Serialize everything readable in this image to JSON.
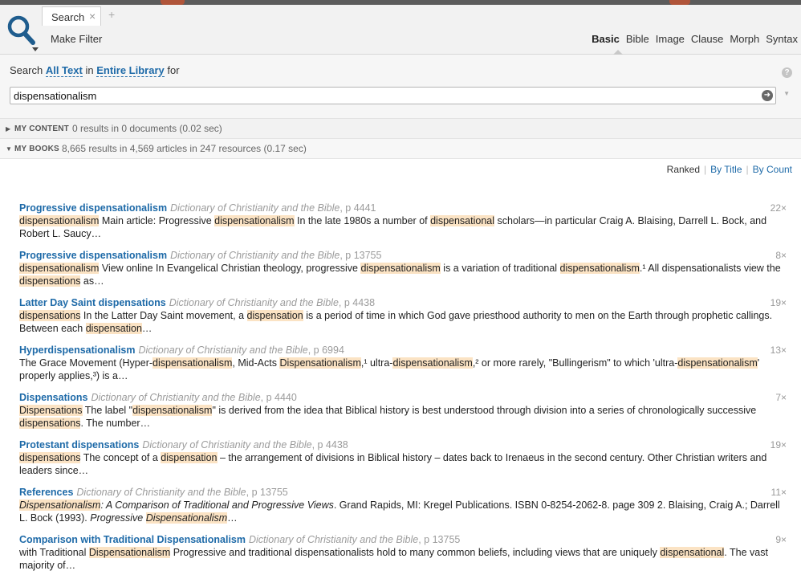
{
  "tab": {
    "label": "Search",
    "close": "×",
    "add": "+"
  },
  "toolbar": {
    "make_filter": "Make Filter"
  },
  "modes": [
    "Basic",
    "Bible",
    "Image",
    "Clause",
    "Morph",
    "Syntax"
  ],
  "query": {
    "prefix": "Search",
    "scope": "All Text",
    "in": "in",
    "collection": "Entire Library",
    "suffix": "for",
    "value": "dispensationalism",
    "help": "?",
    "go": "➜",
    "menu": "▼"
  },
  "sections": [
    {
      "title": "MY CONTENT",
      "info": "0 results in 0 documents (0.02 sec)"
    },
    {
      "title": "MY BOOKS",
      "info": "8,665 results in 4,569 articles in 247 resources (0.17 sec)"
    }
  ],
  "sort": {
    "ranked": "Ranked",
    "by_title": "By Title",
    "by_count": "By Count",
    "sep": "|"
  },
  "colors": {
    "link": "#1e6aa8",
    "highlight": "#fbe3c4"
  },
  "results": [
    {
      "title": "Progressive dispensationalism",
      "source": "Dictionary of Christianity and the Bible",
      "page": ", p 4441",
      "count": "22×",
      "snippet": [
        {
          "t": "dispensationalism",
          "h": true
        },
        {
          "t": " Main article: Progressive "
        },
        {
          "t": "dispensationalism",
          "h": true
        },
        {
          "t": " In the late 1980s a number of "
        },
        {
          "t": "dispensational",
          "h": true
        },
        {
          "t": " scholars—in particular Craig A. Blaising, Darrell L. Bock, and Robert L. Saucy…"
        }
      ]
    },
    {
      "title": "Progressive dispensationalism",
      "source": "Dictionary of Christianity and the Bible",
      "page": ", p 13755",
      "count": "8×",
      "snippet": [
        {
          "t": "dispensationalism",
          "h": true
        },
        {
          "t": " View online In Evangelical Christian theology, progressive "
        },
        {
          "t": "dispensationalism",
          "h": true
        },
        {
          "t": " is a variation of traditional "
        },
        {
          "t": "dispensationalism",
          "h": true
        },
        {
          "t": ".¹ All dispensationalists view the "
        },
        {
          "t": "dispensations",
          "h": true
        },
        {
          "t": " as…"
        }
      ]
    },
    {
      "title": "Latter Day Saint dispensations",
      "source": "Dictionary of Christianity and the Bible",
      "page": ", p 4438",
      "count": "19×",
      "snippet": [
        {
          "t": "dispensations",
          "h": true
        },
        {
          "t": " In the Latter Day Saint movement, a "
        },
        {
          "t": "dispensation",
          "h": true
        },
        {
          "t": " is a period of time in which God gave priesthood authority to men on the Earth through prophetic callings. Between each "
        },
        {
          "t": "dispensation",
          "h": true
        },
        {
          "t": "…"
        }
      ]
    },
    {
      "title": "Hyperdispensationalism",
      "source": "Dictionary of Christianity and the Bible",
      "page": ", p 6994",
      "count": "13×",
      "snippet": [
        {
          "t": "The Grace Movement (Hyper-"
        },
        {
          "t": "dispensationalism",
          "h": true
        },
        {
          "t": ", Mid-Acts "
        },
        {
          "t": "Dispensationalism",
          "h": true
        },
        {
          "t": ",¹ ultra-"
        },
        {
          "t": "dispensationalism",
          "h": true
        },
        {
          "t": ",² or more rarely, \"Bullingerism\" to which 'ultra-"
        },
        {
          "t": "dispensationalism",
          "h": true
        },
        {
          "t": "' properly applies,³) is a…"
        }
      ]
    },
    {
      "title": "Dispensations",
      "source": "Dictionary of Christianity and the Bible",
      "page": ", p 4440",
      "count": "7×",
      "snippet": [
        {
          "t": "Dispensations",
          "h": true
        },
        {
          "t": " The label \""
        },
        {
          "t": "dispensationalism",
          "h": true
        },
        {
          "t": "\" is derived from the idea that Biblical history is best understood through division into a series of chronologically successive "
        },
        {
          "t": "dispensations",
          "h": true
        },
        {
          "t": ". The number…"
        }
      ]
    },
    {
      "title": "Protestant dispensations",
      "source": "Dictionary of Christianity and the Bible",
      "page": ", p 4438",
      "count": "19×",
      "snippet": [
        {
          "t": "dispensations",
          "h": true
        },
        {
          "t": " The concept of a "
        },
        {
          "t": "dispensation",
          "h": true
        },
        {
          "t": " – the arrangement of divisions in Biblical history – dates back to Irenaeus in the second century. Other Christian writers and leaders since…"
        }
      ]
    },
    {
      "title": "References",
      "source": "Dictionary of Christianity and the Bible",
      "page": ", p 13755",
      "count": "11×",
      "snippet": [
        {
          "t": "Dispensationalism",
          "h": true,
          "i": true
        },
        {
          "t": ": A Comparison of Traditional and Progressive Views",
          "i": true
        },
        {
          "t": ". Grand Rapids, MI: Kregel Publications. ISBN 0-8254-2062-8. page 309 2. Blaising, Craig A.; Darrell L. Bock (1993). "
        },
        {
          "t": "Progressive ",
          "i": true
        },
        {
          "t": "Dispensationalism",
          "h": true,
          "i": true
        },
        {
          "t": "…"
        }
      ]
    },
    {
      "title": "Comparison with Traditional Dispensationalism",
      "source": "Dictionary of Christianity and the Bible",
      "page": ", p 13755",
      "count": "9×",
      "snippet": [
        {
          "t": "with Traditional "
        },
        {
          "t": "Dispensationalism",
          "h": true
        },
        {
          "t": " Progressive and traditional dispensationalists hold to many common beliefs, including views that are uniquely "
        },
        {
          "t": "dispensational",
          "h": true
        },
        {
          "t": ". The vast majority of…"
        }
      ]
    }
  ]
}
